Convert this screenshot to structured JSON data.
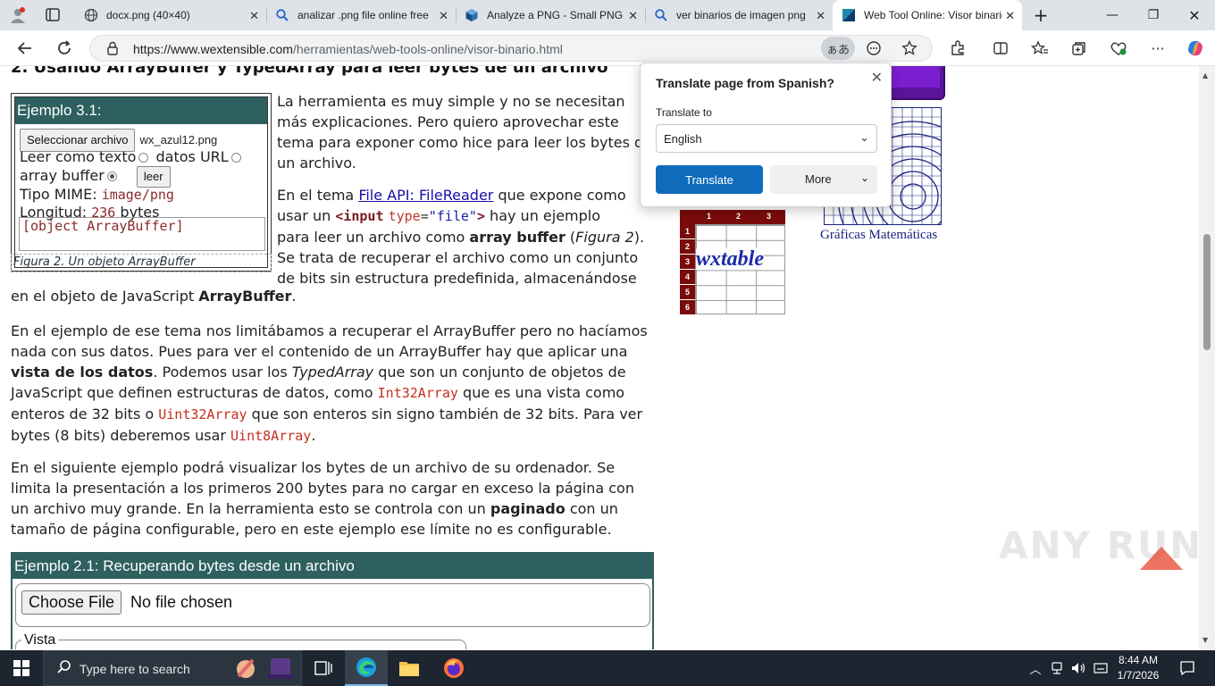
{
  "browser": {
    "tabs": [
      {
        "title": "docx.png (40×40)",
        "icon": "globe-icon"
      },
      {
        "title": "analizar .png file online free",
        "icon": "search-icon"
      },
      {
        "title": "Analyze a PNG - Small PNG",
        "icon": "cube-icon"
      },
      {
        "title": "ver binarios de imagen png",
        "icon": "search-icon"
      },
      {
        "title": "Web Tool Online: Visor binario",
        "icon": "wxt-icon",
        "active": true
      }
    ],
    "new_tab": "+",
    "url_host": "https://www.wextensible.com",
    "url_path": "/herramientas/web-tools-online/visor-binario.html",
    "translate_badge": "ぁあ"
  },
  "article": {
    "heading": "2. Usando ArrayBuffer y TypedArray para leer bytes de un archivo",
    "ex31": {
      "title": "Ejemplo 3.1:",
      "file_button": "Seleccionar archivo",
      "file_name": "wx_azul12.png",
      "read_as": "Leer como texto",
      "opt_dataurl": "datos URL",
      "opt_buffer": "array buffer",
      "read_button": "leer",
      "mime_label": "Tipo MIME:",
      "mime_value": "image/png",
      "len_label": "Longitud:",
      "len_value": "236",
      "len_unit": "bytes",
      "output": "[object ArrayBuffer]"
    },
    "figcaption": "Figura 2. Un objeto ArrayBuffer",
    "p1": [
      "La herramienta es muy simple y no se necesitan",
      "más explicaciones. Pero quiero aprovechar este",
      "tema para exponer como hice para leer los bytes de",
      "un archivo."
    ],
    "p2": {
      "l1a": "En el tema ",
      "l1link": "File API: FileReader",
      "l1b": " que expone como",
      "l2a": "usar un ",
      "l2kw": "<input",
      "l2attr": "type",
      "l2eq": "=",
      "l2str": "\"file\"",
      "l2close": ">",
      "l2b": " hay un ejemplo",
      "l3a": "para leer un archivo como ",
      "l3bold": "array buffer",
      "l3b": " (",
      "l3i": "Figura 2",
      "l3c": ").",
      "l4": "Se trata de recuperar el archivo como un conjunto",
      "l5": "de bits sin estructura predefinida, almacenándose",
      "l6a": "en el objeto de JavaScript ",
      "l6bold": "ArrayBuffer",
      "l6b": "."
    },
    "p3": {
      "l1": "En el ejemplo de ese tema nos limitábamos a recuperar el ArrayBuffer pero no hacíamos",
      "l2": "nada con sus datos. Pues para ver el contenido de un ArrayBuffer hay que aplicar una",
      "l3bold": "vista de los datos",
      "l3a": ". Podemos usar los ",
      "l3i": "TypedArray",
      "l3b": " que son un conjunto de objetos de",
      "l4a": "JavaScript que definen estructuras de datos, como ",
      "l4code": "Int32Array",
      "l4b": " que es una vista como",
      "l5a": "enteros de 32 bits o ",
      "l5code": "Uint32Array",
      "l5b": " que son enteros sin signo también de 32 bits. Para ver",
      "l6a": "bytes (8 bits) deberemos usar ",
      "l6code": "Uint8Array",
      "l6b": "."
    },
    "p4": {
      "l1": "En el siguiente ejemplo podrá visualizar los bytes de un archivo de su ordenador. Se",
      "l2": "limita la presentación a los primeros 200 bytes para no cargar en exceso la página con",
      "l3a": "un archivo muy grande. En la herramienta esto se controla con un ",
      "l3bold": "paginado",
      "l3b": " con un",
      "l4": "tamaño de página configurable, pero en este ejemplo ese límite no es configurable."
    },
    "ex21": {
      "title": "Ejemplo 2.1: Recuperando bytes desde un archivo",
      "choose": "Choose File",
      "nofile": "No file chosen",
      "vista": "Vista"
    }
  },
  "sidebar": {
    "graph_caption": "Gráficas Matemáticas",
    "wxtable_logo": "wxtable",
    "wxtable_cols": [
      "1",
      "2",
      "3"
    ],
    "wxtable_rows": [
      "1",
      "2",
      "3",
      "4",
      "5",
      "6"
    ]
  },
  "translate_popup": {
    "title": "Translate page from Spanish?",
    "label": "Translate to",
    "language": "English",
    "translate": "Translate",
    "more": "More"
  },
  "watermark": "ANY RUN",
  "taskbar": {
    "search_placeholder": "Type here to search",
    "time": "8:44 AM",
    "date": "1/7/2026"
  }
}
